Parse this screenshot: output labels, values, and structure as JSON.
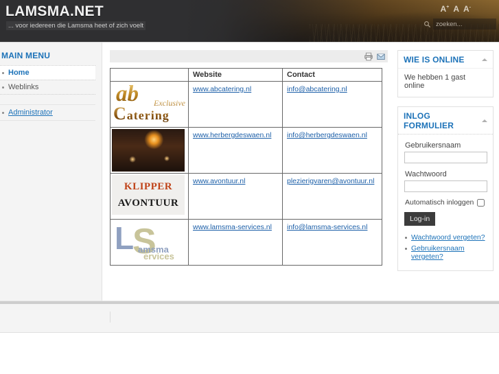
{
  "header": {
    "site_title": "LAMSMA.NET",
    "slogan": "... voor iedereen die Lamsma heet of zich voelt",
    "font_size_increase": "A",
    "font_size_normal": "A",
    "font_size_decrease": "A",
    "font_size_increase_sup": "+",
    "font_size_decrease_sup": "-",
    "search_placeholder": "zoeken...",
    "search_value": ""
  },
  "sidebar_left": {
    "main_menu": {
      "title": "MAIN MENU",
      "items": [
        {
          "label": "Home",
          "active": true
        },
        {
          "label": "Weblinks",
          "active": false
        }
      ]
    },
    "admin_menu": {
      "items": [
        {
          "label": "Administrator"
        }
      ]
    }
  },
  "content": {
    "toolbar": {
      "print_title": "Afdrukken",
      "email_title": "E-mail"
    },
    "table": {
      "headers": [
        "",
        "Website",
        "Contact"
      ],
      "rows": [
        {
          "logo": "abc-exclusive-catering-logo",
          "logo_text_1": "ab",
          "logo_text_2": "Exclusive",
          "logo_text_3": "atering",
          "logo_text_3_initial": "C",
          "website": "www.abcatering.nl",
          "contact": "info@abcatering.nl"
        },
        {
          "logo": "herberg-de-swaen-photo",
          "website": "www.herbergdeswaen.nl",
          "contact": "info@herbergdeswaen.nl"
        },
        {
          "logo": "klipper-avontuur-logo",
          "logo_text_1": "KLIPPER",
          "logo_text_2": "AVONTUUR",
          "website": "www.avontuur.nl",
          "contact": "plezierigvaren@avontuur.nl"
        },
        {
          "logo": "lamsma-services-logo",
          "logo_text_1": "L",
          "logo_text_2": "S",
          "logo_text_3": "amsma",
          "logo_text_4": "ervices",
          "website": "www.lamsma-services.nl",
          "contact": "info@lamsma-services.nl"
        }
      ]
    }
  },
  "sidebar_right": {
    "who_is_online": {
      "title": "WIE IS ONLINE",
      "text": "We hebben 1 gast online"
    },
    "login_form": {
      "title": "INLOG FORMULIER",
      "username_label": "Gebruikersnaam",
      "username_value": "",
      "password_label": "Wachtwoord",
      "password_value": "",
      "remember_label": "Automatisch inloggen",
      "remember_checked": false,
      "submit_label": "Log-in",
      "links": [
        "Wachtwoord vergeten?",
        "Gebruikersnaam vergeten?"
      ]
    }
  },
  "colors": {
    "accent_blue": "#1c72b8",
    "link_blue": "#1c5fa8",
    "header_dark": "#2f2f31",
    "sidebar_bg": "#f4f4f4",
    "button_dark": "#3c3c3c"
  }
}
